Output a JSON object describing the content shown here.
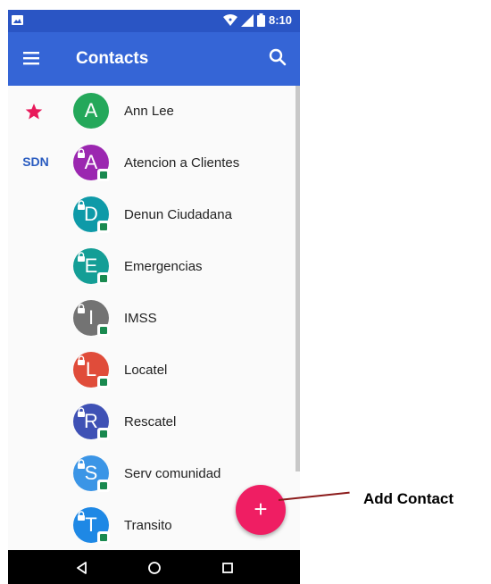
{
  "status_bar": {
    "time": "8:10"
  },
  "app_bar": {
    "title": "Contacts"
  },
  "contacts": [
    {
      "name": "Ann Lee",
      "initial": "A",
      "color": "#24a85a",
      "side_label": "",
      "favorite": true,
      "sim": false
    },
    {
      "name": "Atencion a Clientes",
      "initial": "A",
      "color": "#9b27b0",
      "side_label": "SDN",
      "favorite": false,
      "sim": true
    },
    {
      "name": "Denun Ciudadana",
      "initial": "D",
      "color": "#0e9aa8",
      "side_label": "",
      "favorite": false,
      "sim": true
    },
    {
      "name": "Emergencias",
      "initial": "E",
      "color": "#149e96",
      "side_label": "",
      "favorite": false,
      "sim": true
    },
    {
      "name": "IMSS",
      "initial": "I",
      "color": "#737373",
      "side_label": "",
      "favorite": false,
      "sim": true
    },
    {
      "name": "Locatel",
      "initial": "L",
      "color": "#e04c3a",
      "side_label": "",
      "favorite": false,
      "sim": true
    },
    {
      "name": "Rescatel",
      "initial": "R",
      "color": "#3f51b5",
      "side_label": "",
      "favorite": false,
      "sim": true
    },
    {
      "name": "Serv comunidad",
      "initial": "S",
      "color": "#3b95e6",
      "side_label": "",
      "favorite": false,
      "sim": true
    },
    {
      "name": "Transito",
      "initial": "T",
      "color": "#1e88e5",
      "side_label": "",
      "favorite": false,
      "sim": true
    }
  ],
  "fab": {
    "label": "+",
    "color": "#ef1e63"
  },
  "annotation": {
    "label": "Add Contact"
  },
  "colors": {
    "status_bar": "#2a55c4",
    "app_bar": "#3565d6",
    "favorite_star": "#e8195a",
    "sdn_label": "#2a5cc0"
  },
  "icons": {
    "menu": "hamburger-menu-icon",
    "search": "search-icon",
    "star": "star-icon",
    "back": "back-triangle-icon",
    "home": "home-circle-icon",
    "recents": "recents-square-icon"
  }
}
